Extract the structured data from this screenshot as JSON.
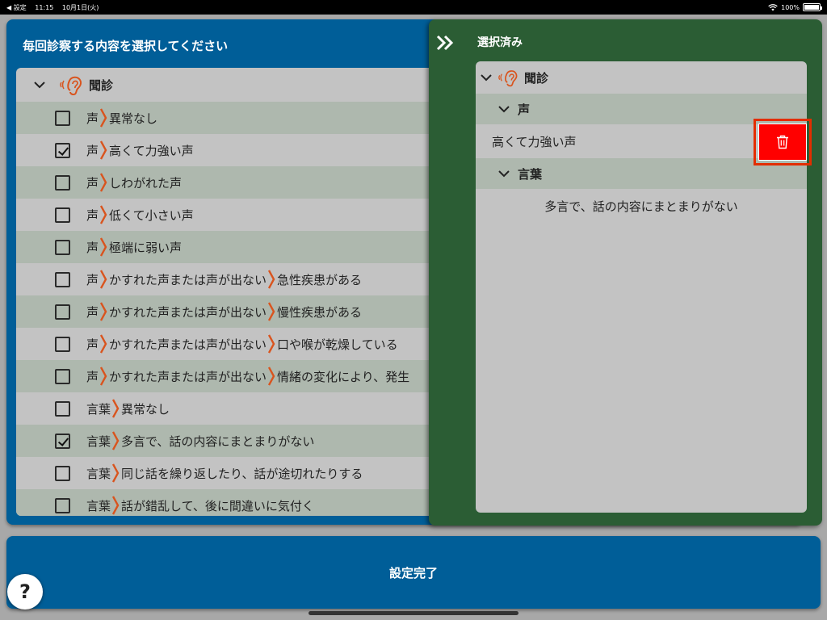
{
  "statusbar": {
    "back": "◀ 設定",
    "time": "11:15",
    "date": "10月1日(火)",
    "battery": "100%",
    "battery_level": 1.0
  },
  "left_panel": {
    "title": "毎回診察する内容を選択してください",
    "category": "聞診",
    "rows": [
      {
        "checked": false,
        "parts": [
          "声",
          "異常なし"
        ]
      },
      {
        "checked": true,
        "parts": [
          "声",
          "高くて力強い声"
        ]
      },
      {
        "checked": false,
        "parts": [
          "声",
          "しわがれた声"
        ]
      },
      {
        "checked": false,
        "parts": [
          "声",
          "低くて小さい声"
        ]
      },
      {
        "checked": false,
        "parts": [
          "声",
          "極端に弱い声"
        ]
      },
      {
        "checked": false,
        "parts": [
          "声",
          "かすれた声または声が出ない",
          "急性疾患がある"
        ]
      },
      {
        "checked": false,
        "parts": [
          "声",
          "かすれた声または声が出ない",
          "慢性疾患がある"
        ]
      },
      {
        "checked": false,
        "parts": [
          "声",
          "かすれた声または声が出ない",
          "口や喉が乾燥している"
        ]
      },
      {
        "checked": false,
        "parts": [
          "声",
          "かすれた声または声が出ない",
          "情緒の変化により、発生"
        ]
      },
      {
        "checked": false,
        "parts": [
          "言葉",
          "異常なし"
        ]
      },
      {
        "checked": true,
        "parts": [
          "言葉",
          "多言で、話の内容にまとまりがない"
        ]
      },
      {
        "checked": false,
        "parts": [
          "言葉",
          "同じ話を繰り返したり、話が途切れたりする"
        ]
      },
      {
        "checked": false,
        "parts": [
          "言葉",
          "話が錯乱して、後に間違いに気付く"
        ]
      }
    ]
  },
  "right_panel": {
    "title": "選択済み",
    "category": "聞診",
    "groups": [
      {
        "label": "声",
        "items": [
          "高くて力強い声"
        ]
      },
      {
        "label": "言葉",
        "items": [
          "多言で、話の内容にまとまりがない"
        ]
      }
    ]
  },
  "bottom": {
    "confirm_label": "設定完了",
    "help_label": "?"
  },
  "colors": {
    "blue_panel": "#005e98",
    "green_panel": "#2b5d34",
    "accent_separator": "#d9541e",
    "delete_red": "#ff0000"
  }
}
